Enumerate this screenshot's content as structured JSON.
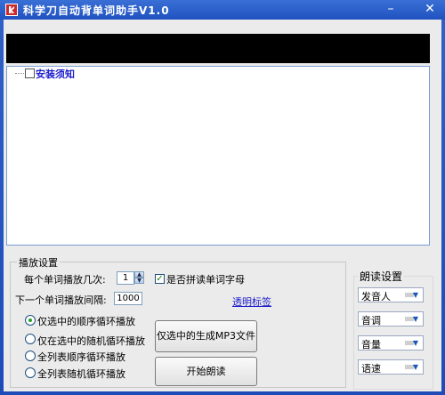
{
  "window": {
    "title": "科学刀自动背单词助手V1.0"
  },
  "tree": {
    "item_label": "安装须知"
  },
  "playback": {
    "legend": "播放设置",
    "times_label": "每个单词播放几次:",
    "times_value": "1",
    "spell_check_label": "是否拼读单词字母",
    "spell_checked": true,
    "interval_label": "下一个单词播放间隔:",
    "interval_value": "1000",
    "transparent_label": "透明标签",
    "radios": [
      {
        "label": "仅选中的顺序循环播放",
        "selected": true
      },
      {
        "label": "仅在选中的随机循环播放",
        "selected": false
      },
      {
        "label": "全列表顺序循环播放",
        "selected": false
      },
      {
        "label": "全列表随机循环播放",
        "selected": false
      }
    ],
    "mp3_button": "仅选中的生成MP3文件",
    "start_button": "开始朗读"
  },
  "reading": {
    "legend": "朗读设置",
    "selects": [
      "发音人",
      "音调",
      "音量",
      "语速"
    ]
  },
  "colors": {
    "titlebar": "#1f52c0",
    "link": "#1d1dcc",
    "check": "#26a026"
  }
}
